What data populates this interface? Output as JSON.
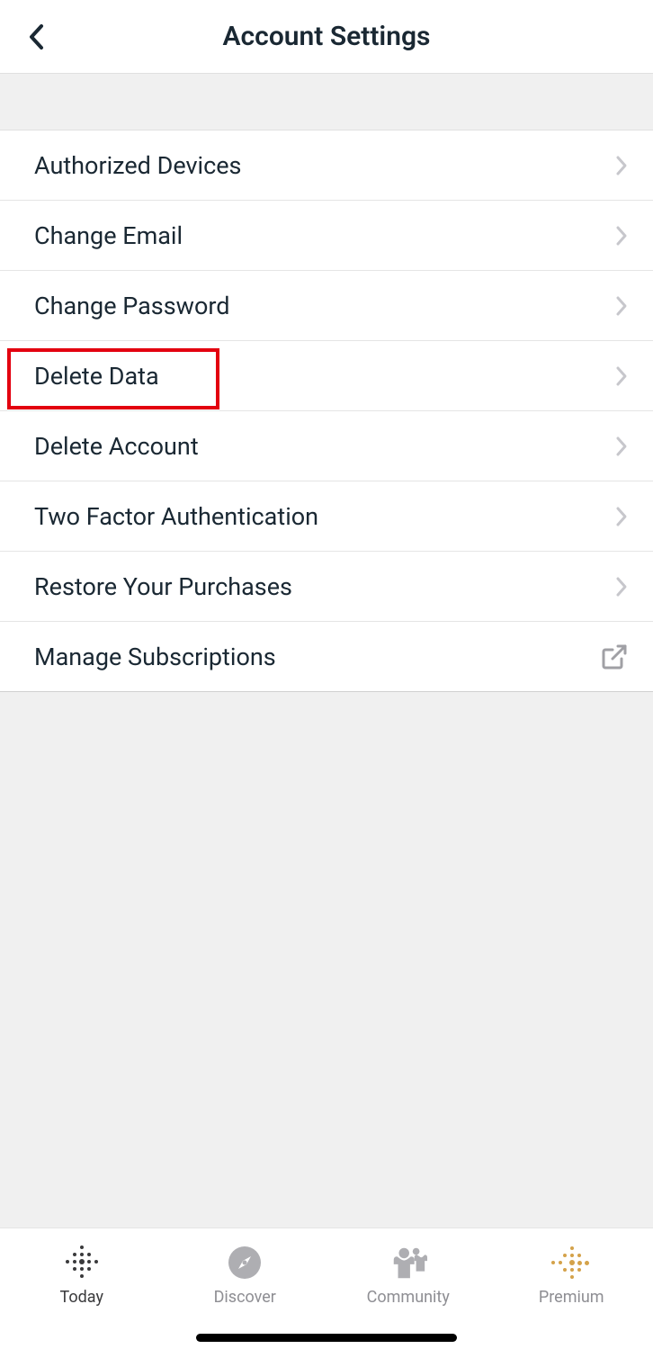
{
  "header": {
    "title": "Account Settings"
  },
  "settings": [
    {
      "label": "Authorized Devices",
      "icon": "chevron"
    },
    {
      "label": "Change Email",
      "icon": "chevron"
    },
    {
      "label": "Change Password",
      "icon": "chevron"
    },
    {
      "label": "Delete Data",
      "icon": "chevron"
    },
    {
      "label": "Delete Account",
      "icon": "chevron"
    },
    {
      "label": "Two Factor Authentication",
      "icon": "chevron"
    },
    {
      "label": "Restore Your Purchases",
      "icon": "chevron"
    },
    {
      "label": "Manage Subscriptions",
      "icon": "external"
    }
  ],
  "highlighted_item_index": 3,
  "tabs": [
    {
      "label": "Today",
      "active": true
    },
    {
      "label": "Discover",
      "active": false
    },
    {
      "label": "Community",
      "active": false
    },
    {
      "label": "Premium",
      "active": false
    }
  ]
}
